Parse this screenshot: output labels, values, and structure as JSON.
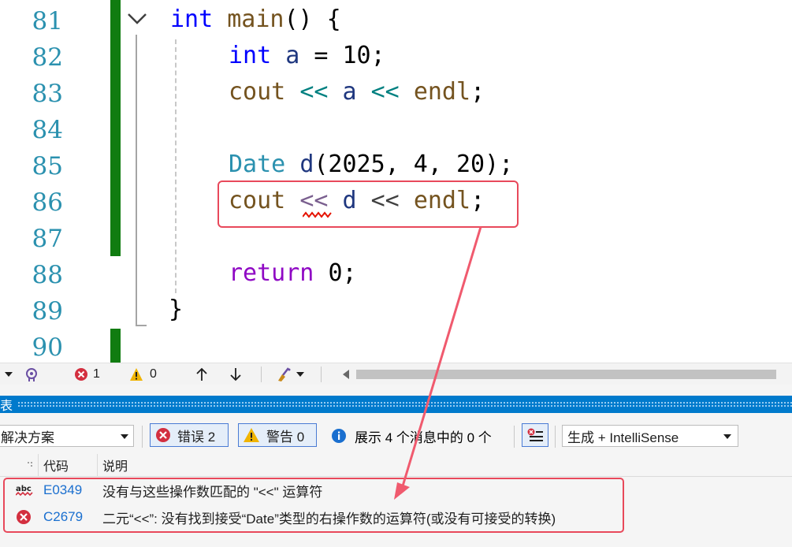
{
  "editor": {
    "line_numbers": [
      "81",
      "82",
      "83",
      "84",
      "85",
      "86",
      "87",
      "88",
      "89",
      "90"
    ],
    "lines": {
      "l81": {
        "kw": "int",
        "fn": "main",
        "rest": "() {"
      },
      "l82": {
        "kw": "int",
        "vr": "a",
        "eq": " = ",
        "nu": "10",
        "end": ";"
      },
      "l83": {
        "fn1": "cout",
        "op1": "<<",
        "vr": "a",
        "op2": "<<",
        "fn2": "endl",
        "end": ";"
      },
      "l85": {
        "ty": "Date",
        "vr": "d",
        "args": "(2025, 4, 20)",
        "end": ";"
      },
      "l86": {
        "fn1": "cout",
        "op1": "<<",
        "vr": "d",
        "op2": "<<",
        "fn2": "endl",
        "end": ";"
      },
      "l88": {
        "kw": "return",
        "nu": "0",
        "end": ";"
      },
      "l89": {
        "brace": "}"
      }
    }
  },
  "status_strip": {
    "error_count": "1",
    "warning_count": "0"
  },
  "error_list": {
    "title": "表",
    "scope_combo": "解决方案",
    "errors_button": "错误 2",
    "warnings_button": "警告 0",
    "messages_button": "展示 4 个消息中的 0 个",
    "build_combo": "生成 + IntelliSense",
    "columns": {
      "code": "代码",
      "description": "说明"
    },
    "rows": [
      {
        "icon": "intellisense-error-icon",
        "badge": "abc",
        "code": "E0349",
        "description": "没有与这些操作数匹配的 \"<<\" 运算符"
      },
      {
        "icon": "error-icon",
        "code": "C2679",
        "description": "二元“<<”: 没有找到接受“Date”类型的右操作数的运算符(或没有可接受的转换)"
      }
    ]
  },
  "colors": {
    "accent": "#007acc",
    "error": "#d32f3f",
    "warning": "#f0b400",
    "annotation": "#e8495b",
    "change_marker": "#107c10"
  }
}
